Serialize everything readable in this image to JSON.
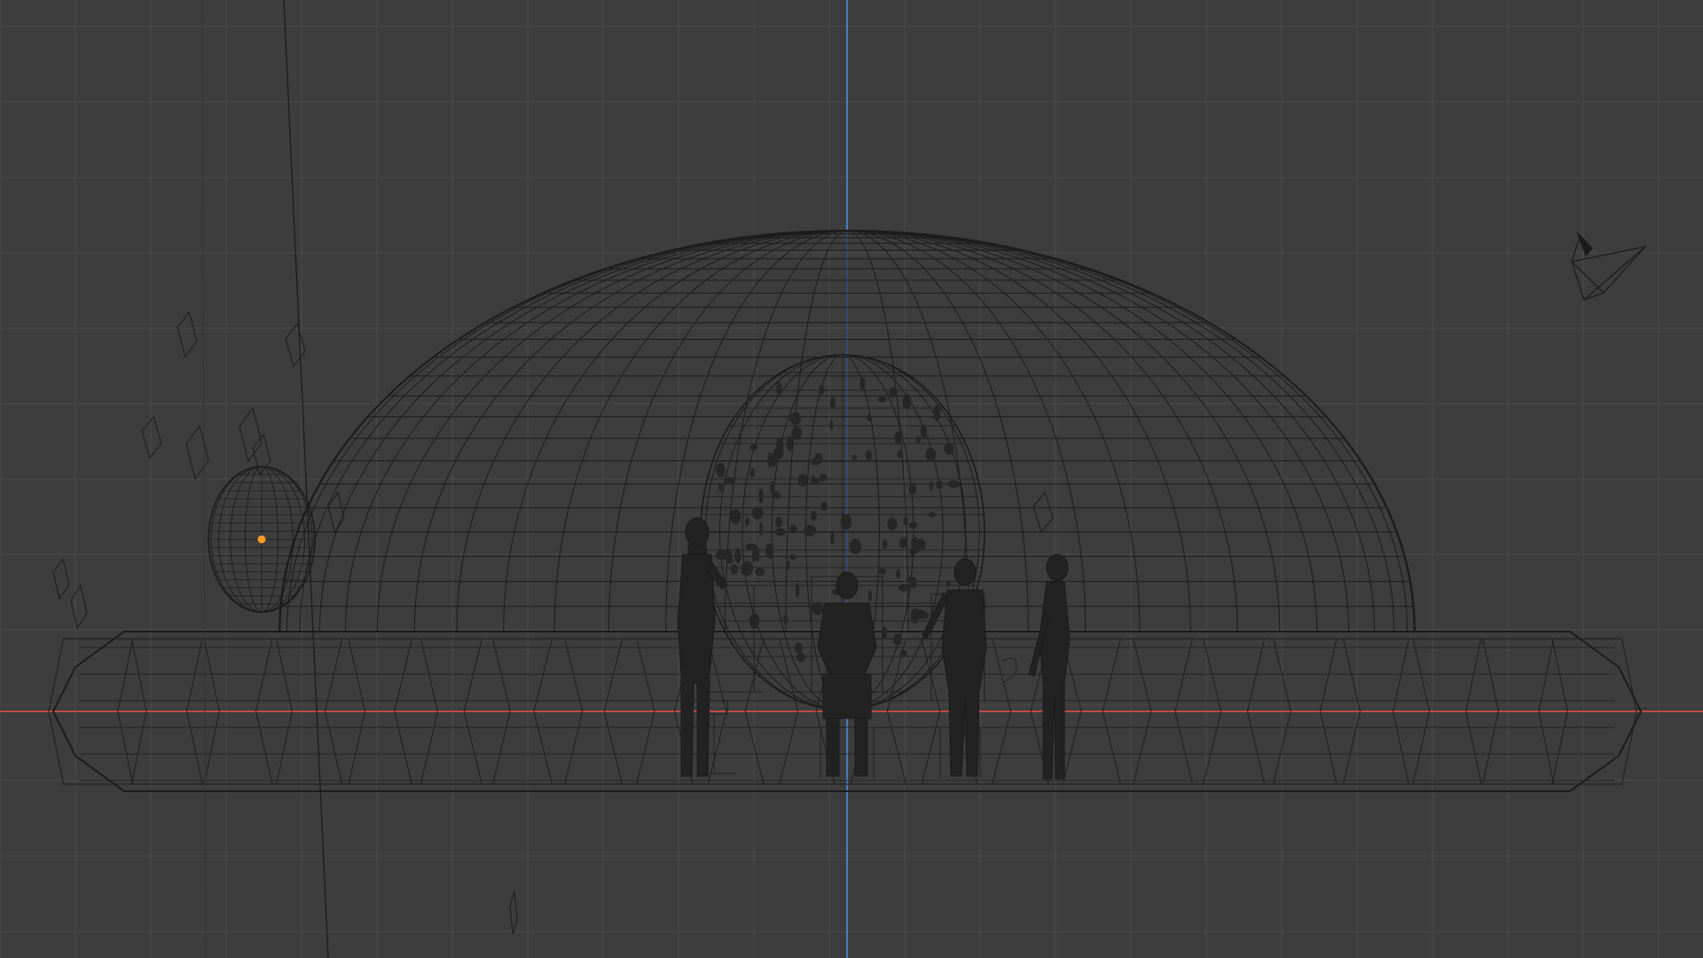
{
  "viewport": {
    "type": "3d-wireframe-orthographic-view",
    "background_color": "#3d3d3d",
    "grid_color": "#4b4b4b",
    "x_axis_color": "#c24a4a",
    "z_axis_color": "#4a7bc2",
    "wire_color": "#1c1c1c",
    "selection_color": "#ff9a1f"
  },
  "scene": {
    "objects": [
      {
        "name": "dome",
        "icon": "wire-dome"
      },
      {
        "name": "saucer-ring",
        "icon": "wire-torus"
      },
      {
        "name": "inner-egg-sphere",
        "icon": "wire-sphere"
      },
      {
        "name": "small-sphere",
        "icon": "wire-sphere",
        "selected_origin": true
      },
      {
        "name": "figure-1",
        "icon": "human-silhouette"
      },
      {
        "name": "figure-2-seated",
        "icon": "human-silhouette"
      },
      {
        "name": "figure-3",
        "icon": "human-silhouette"
      },
      {
        "name": "figure-4",
        "icon": "human-silhouette"
      },
      {
        "name": "camera",
        "icon": "camera-icon"
      },
      {
        "name": "floating-planes",
        "icon": "plane-icon"
      }
    ]
  }
}
